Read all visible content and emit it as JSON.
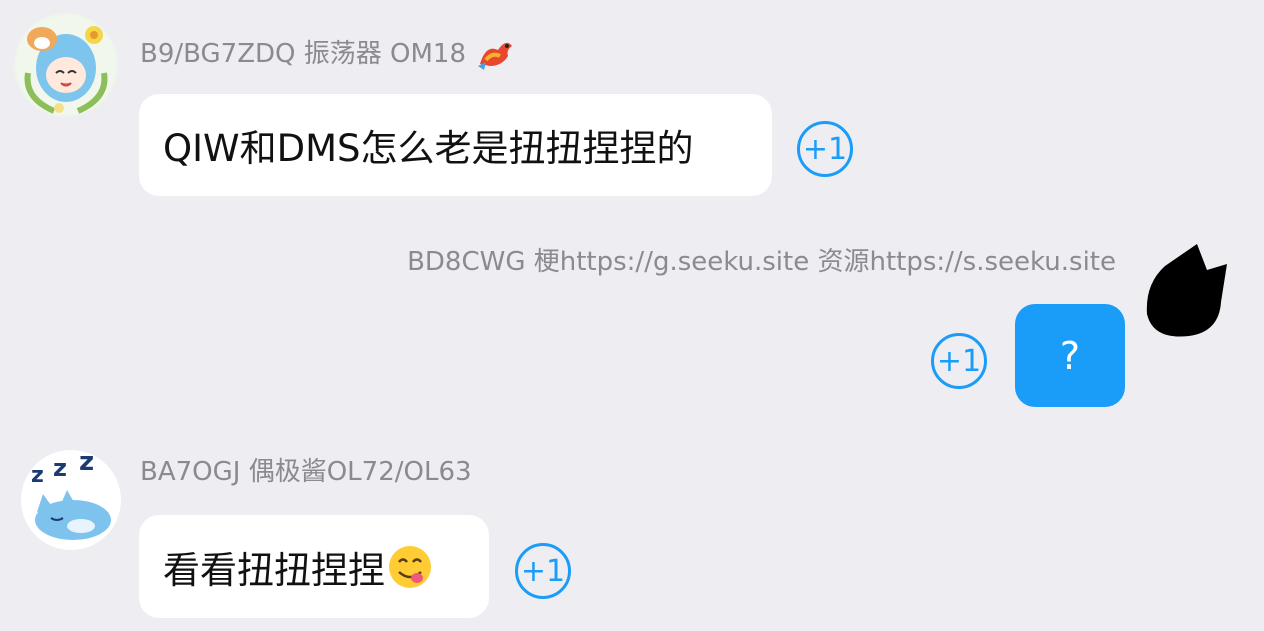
{
  "colors": {
    "background": "#ededf2",
    "self_bubble": "#1a9cf9",
    "accent": "#1a9cf9",
    "sender_text": "#8a8a90"
  },
  "messages": [
    {
      "side": "left",
      "sender": "B9/BG7ZDQ 振荡器 OM18",
      "badge_icon": "dragon-emoji-icon",
      "avatar_icon": "anime-girl-with-shiba-avatar",
      "text": "QIW和DMS怎么老是扭扭捏捏的",
      "reaction": "+1"
    },
    {
      "side": "right",
      "sender": "BD8CWG 梗https://g.seeku.site  资源https://s.seeku.site",
      "avatar_icon": "black-cat-silhouette-avatar",
      "text": "?",
      "reaction": "+1"
    },
    {
      "side": "left",
      "sender": "BA7OGJ 偶极酱OL72/OL63",
      "avatar_icon": "sleeping-blue-cat-avatar",
      "text": "看看扭扭捏捏",
      "emoji_icon": "yum-face-emoji-icon",
      "reaction": "+1"
    }
  ]
}
